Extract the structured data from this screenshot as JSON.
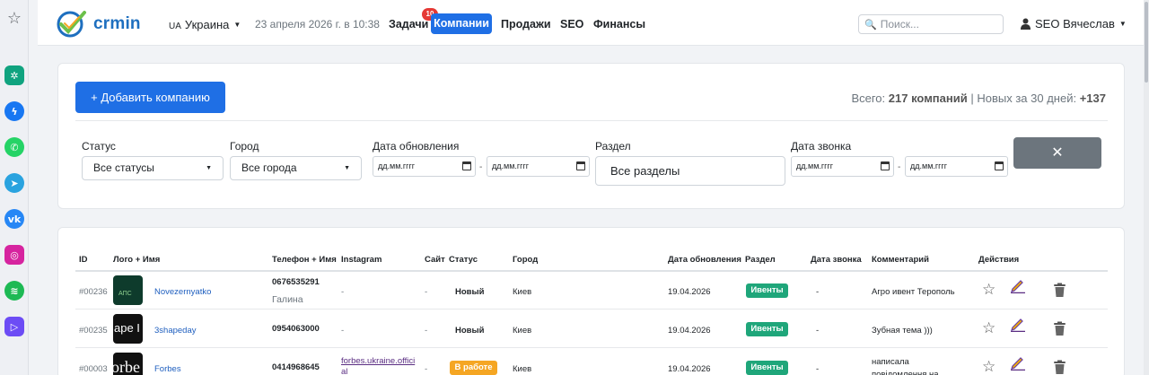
{
  "brand": {
    "name": "crmin"
  },
  "navbar": {
    "country_code": "UA",
    "country": "Украина",
    "datetime": "23 апреля 2026 г. в 10:38",
    "links": {
      "tasks": "Задачи",
      "companies": "Компании",
      "sales": "Продажи",
      "seo": "SEO",
      "finance": "Финансы"
    },
    "tasks_badge": "10",
    "search_placeholder": "Поиск...",
    "user": "SEO Вячеслав"
  },
  "toolbar": {
    "add_label": "+ Добавить компанию",
    "stats_total_prefix": "Всего:",
    "stats_total": "217 компаний",
    "stats_new_prefix": "| Новых за 30 дней:",
    "stats_new": "+137"
  },
  "filters": {
    "status_label": "Статус",
    "status_value": "Все статусы",
    "city_label": "Город",
    "city_value": "Все города",
    "updated_label": "Дата обновления",
    "date_placeholder": "дд.мм.гггг",
    "section_label": "Раздел",
    "section_value": "Все разделы",
    "call_label": "Дата звонка",
    "reset_label": "✕"
  },
  "table": {
    "headers": {
      "id": "ID",
      "logo_name": "Лого + Имя",
      "phone": "Телефон + Имя",
      "instagram": "Instagram",
      "site": "Сайт",
      "status": "Статус",
      "city": "Город",
      "updated": "Дата обновления",
      "section": "Раздел",
      "call_date": "Дата звонка",
      "comment": "Комментарий",
      "actions": "Действия"
    },
    "rows": [
      {
        "id": "#00236",
        "logo_text": "АПС",
        "name": "Novezernyatko",
        "phone": "0676535291",
        "contact": "Галина",
        "instagram": "-",
        "site": "-",
        "status": "Новый",
        "city": "Киев",
        "updated": "19.04.2026",
        "section": "Ивенты",
        "call_date": "-",
        "comment": "Агро ивент Терополь"
      },
      {
        "id": "#00235",
        "logo_text": "ape I",
        "name": "3shapeday",
        "phone": "0954063000",
        "contact": "",
        "instagram": "-",
        "site": "-",
        "status": "Новый",
        "city": "Киев",
        "updated": "19.04.2026",
        "section": "Ивенты",
        "call_date": "-",
        "comment": "Зубная тема )))"
      },
      {
        "id": "#00003",
        "logo_text": "orbe",
        "name": "Forbes",
        "phone": "0414968645",
        "contact": "",
        "instagram": "forbes.ukraine.offici al",
        "site": "-",
        "status": "В работе",
        "city": "Киев",
        "updated": "19.04.2026",
        "section": "Ивенты",
        "call_date": "-",
        "comment": "написала повідомлення на"
      }
    ]
  },
  "colors": {
    "primary": "#1f6fe5",
    "success": "#1fa67a",
    "warning": "#f5a623",
    "secondary": "#6c757d",
    "danger": "#e53935"
  },
  "icons": [
    "star-icon",
    "chatgpt-icon",
    "messenger-icon",
    "whatsapp-icon",
    "telegram-icon",
    "vk-icon",
    "instagram-icon",
    "spotify-icon",
    "player-icon",
    "search-icon",
    "user-icon",
    "calendar-icon",
    "close-icon",
    "favorite-star-icon",
    "edit-pencil-icon",
    "trash-icon"
  ]
}
